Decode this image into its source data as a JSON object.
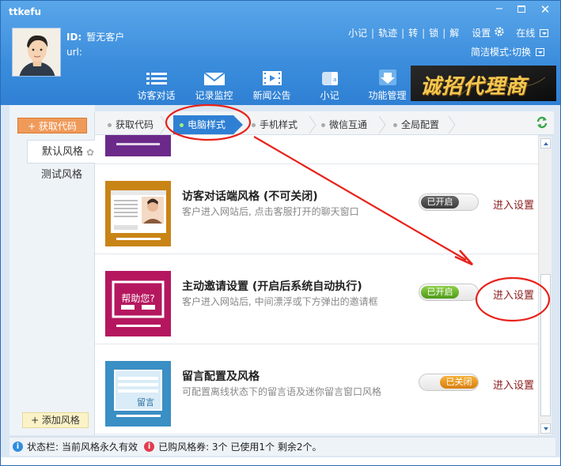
{
  "window": {
    "title": "ttkefu",
    "min_label": "−",
    "close_label": "✕"
  },
  "user": {
    "id_label": "ID:",
    "id_value": "暂无客户",
    "url_label": "url:"
  },
  "top_links": [
    "小记",
    "轨迹",
    "转",
    "锁",
    "解"
  ],
  "settings_label": "设置",
  "status_value": "在线",
  "mode": {
    "label": "简洁模式:",
    "action": "切换"
  },
  "nav": [
    {
      "label": "访客对话",
      "icon": "list-icon"
    },
    {
      "label": "记录监控",
      "icon": "mail-icon"
    },
    {
      "label": "新闻公告",
      "icon": "video-icon"
    },
    {
      "label": "小记",
      "icon": "notebook-icon"
    },
    {
      "label": "功能管理",
      "icon": "download-icon"
    }
  ],
  "banner": {
    "text": "诚招代理商"
  },
  "left": {
    "get_code_button": "+ 获取代码",
    "styles": [
      "默认风格",
      "测试风格"
    ],
    "add_style_button": "+ 添加风格"
  },
  "tabs": [
    "获取代码",
    "电脑样式",
    "手机样式",
    "微信互通",
    "全局配置"
  ],
  "active_tab": 1,
  "rows": [
    {
      "title": "访客对话端风格 (不可关闭)",
      "desc": "客户进入网站后, 点击客服打开的聊天窗口",
      "toggle": "已开启",
      "link": "进入设置",
      "thumb_color": "#c98416"
    },
    {
      "title": "主动邀请设置 (开启后系统自动执行)",
      "desc": "客户进入网站后, 中间漂浮或下方弹出的邀请框",
      "toggle": "已开启",
      "link": "进入设置",
      "thumb_color": "#b5175f",
      "thumb_text": "帮助您?"
    },
    {
      "title": "留言配置及风格",
      "desc": "可配置离线状态下的留言语及迷你留言窗口风格",
      "toggle": "已关闭",
      "link": "进入设置",
      "thumb_color": "#3a8fc4",
      "thumb_text": "留言"
    }
  ],
  "statusbar": {
    "label": "状态栏:",
    "text1": "当前风格永久有效",
    "text2": "已购风格券: 3个 已使用1个 剩余2个。"
  },
  "colors": {
    "header_blue": "#3b8ddc",
    "accent_orange": "#f09a5a",
    "annotation_red": "#e8221b"
  }
}
